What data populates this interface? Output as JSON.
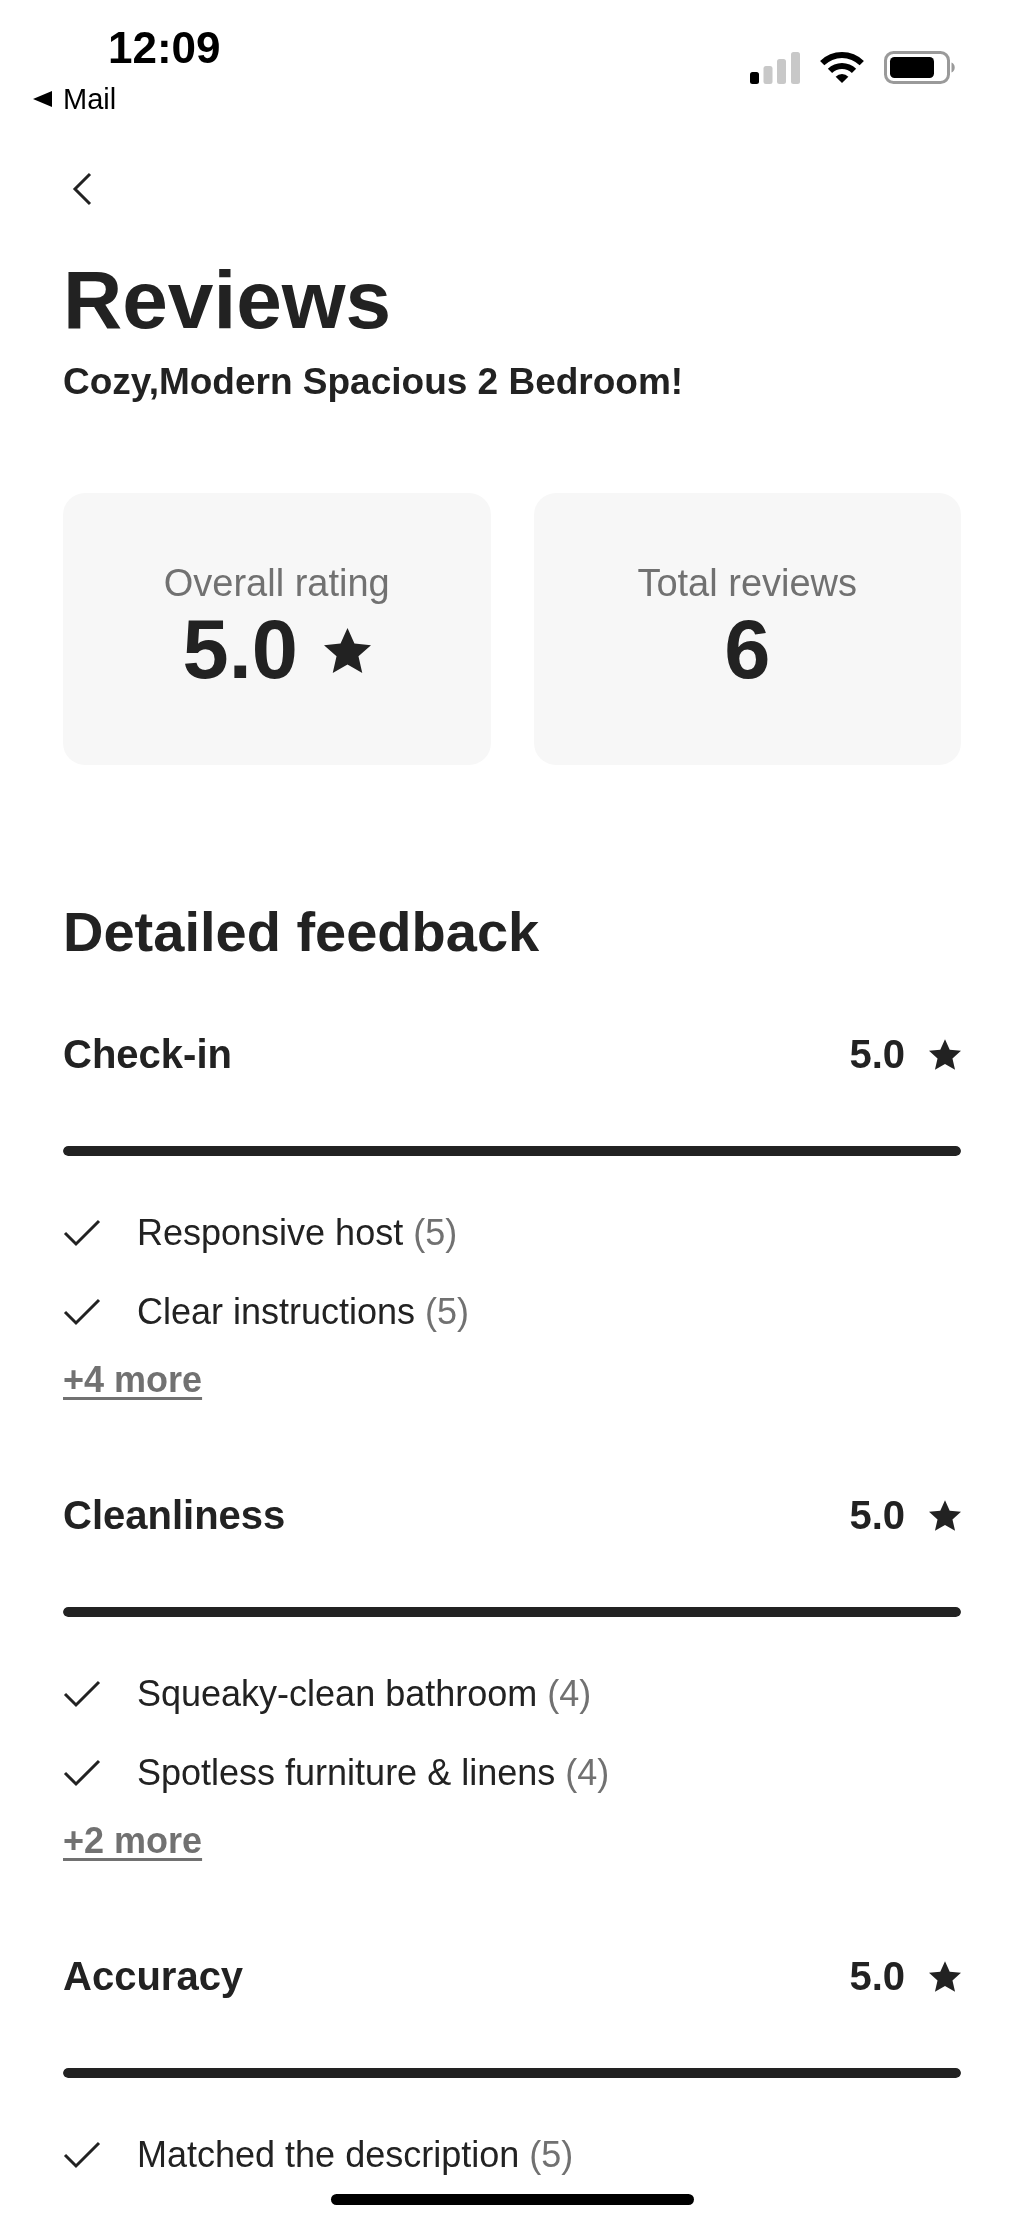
{
  "status_bar": {
    "time": "12:09",
    "back_link": "Mail"
  },
  "header": {
    "title": "Reviews",
    "subtitle": "Cozy,Modern Spacious 2 Bedroom!"
  },
  "summary_cards": [
    {
      "kind": "rating",
      "label": "Overall rating",
      "value": "5.0"
    },
    {
      "kind": "count",
      "label": "Total reviews",
      "value": "6"
    }
  ],
  "detailed_feedback": {
    "title": "Detailed feedback",
    "categories": [
      {
        "name": "Check-in",
        "rating": "5.0",
        "level": 1,
        "highlights": [
          {
            "label": "Responsive host",
            "count": "(5)"
          },
          {
            "label": "Clear instructions",
            "count": "(5)"
          }
        ],
        "more_link": "+4 more"
      },
      {
        "name": "Cleanliness",
        "rating": "5.0",
        "level": 1,
        "highlights": [
          {
            "label": "Squeaky-clean bathroom",
            "count": "(4)"
          },
          {
            "label": "Spotless furniture & linens",
            "count": "(4)"
          }
        ],
        "more_link": "+2 more"
      },
      {
        "name": "Accuracy",
        "rating": "5.0",
        "level": 1,
        "highlights": [
          {
            "label": "Matched the description",
            "count": "(5)"
          }
        ]
      }
    ]
  }
}
